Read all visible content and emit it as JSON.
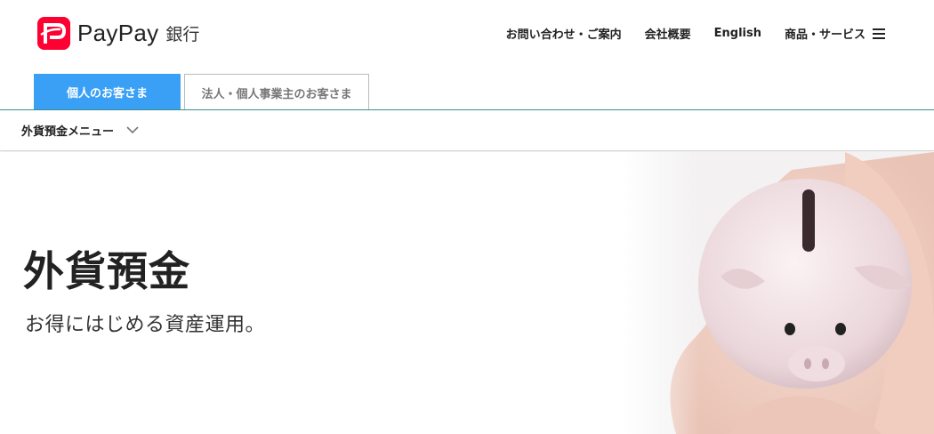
{
  "brand": {
    "name": "PayPay",
    "sub": "銀行",
    "accent": "#ff0033"
  },
  "top_nav": {
    "items": [
      "お問い合わせ・ご案内",
      "会社概要",
      "English",
      "商品・サービス"
    ]
  },
  "tabs": [
    {
      "label": "個人のお客さま",
      "active": true,
      "color": "#3aa0f5"
    },
    {
      "label": "法人・個人事業主のお客さま",
      "active": false
    }
  ],
  "submenu": {
    "label": "外貨預金メニュー",
    "icon": "chevron-down-icon"
  },
  "hero": {
    "title": "外貨預金",
    "subtitle": "お得にはじめる資産運用。",
    "image": "piggy-bank-in-hands"
  }
}
